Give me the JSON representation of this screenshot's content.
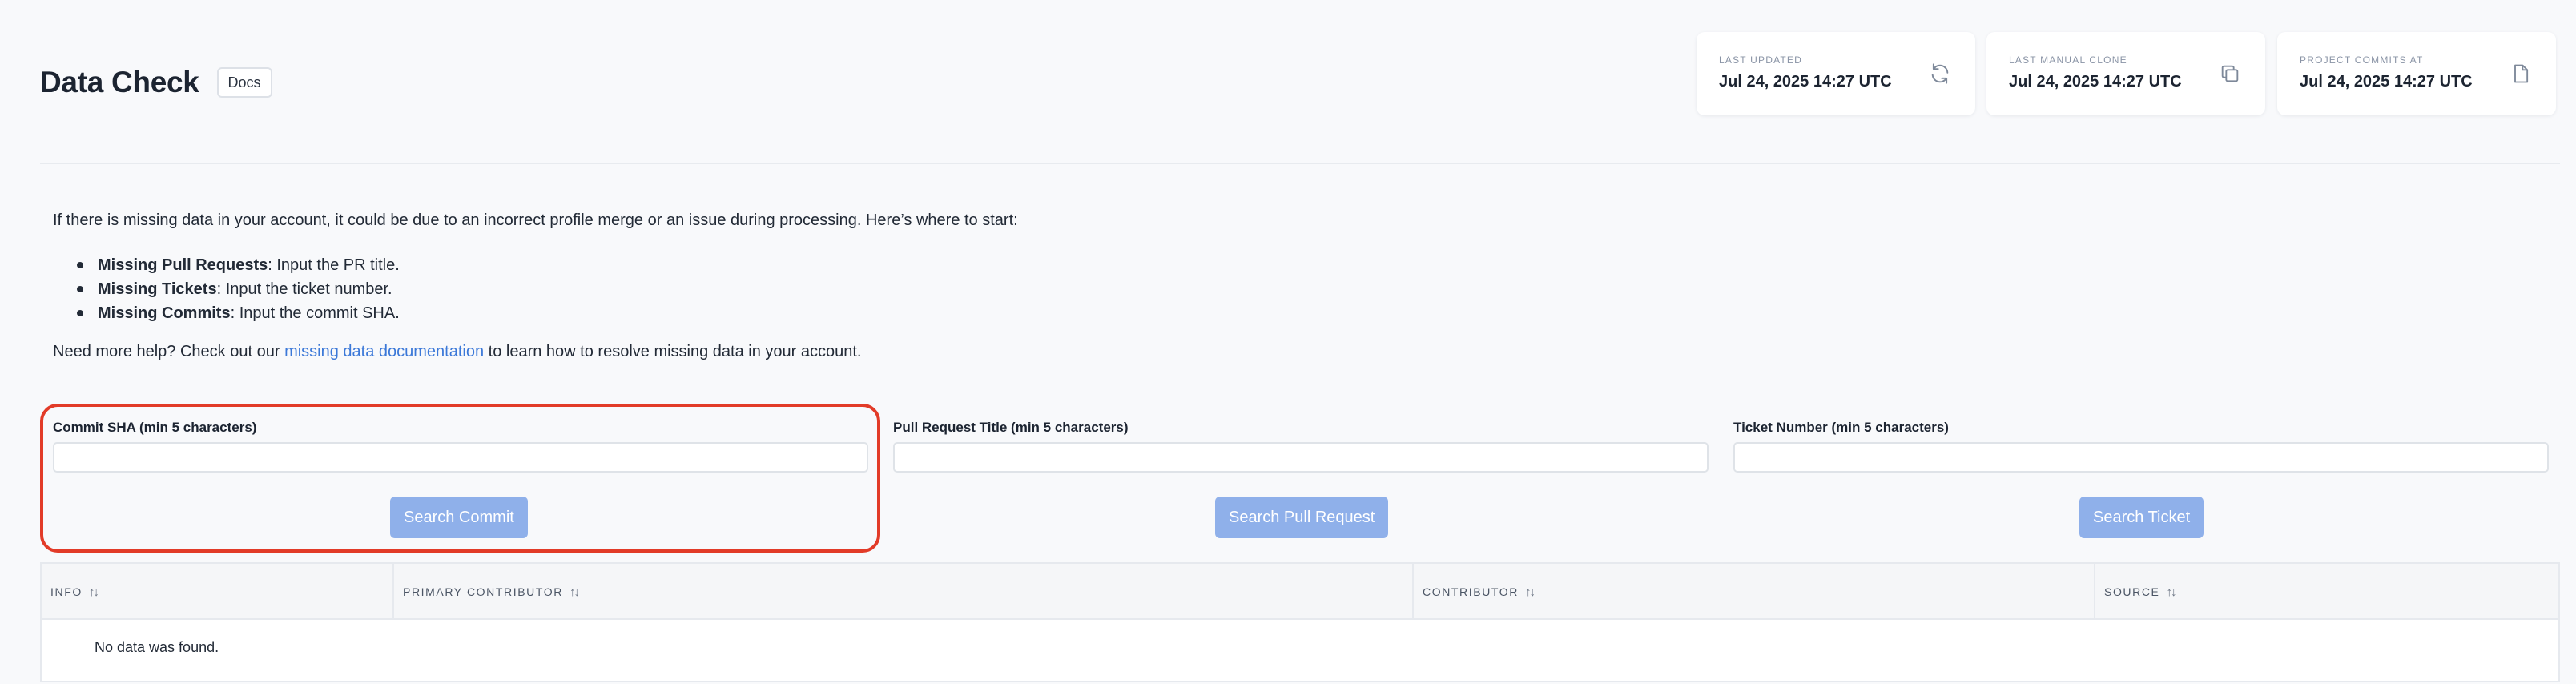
{
  "header": {
    "title": "Data Check",
    "docs_label": "Docs"
  },
  "stats": [
    {
      "label": "LAST UPDATED",
      "value": "Jul 24, 2025 14:27 UTC",
      "icon": "refresh-icon"
    },
    {
      "label": "LAST MANUAL CLONE",
      "value": "Jul 24, 2025 14:27 UTC",
      "icon": "copy-icon"
    },
    {
      "label": "PROJECT COMMITS AT",
      "value": "Jul 24, 2025 14:27 UTC",
      "icon": "document-icon"
    }
  ],
  "intro": {
    "text": "If there is missing data in your account, it could be due to an incorrect profile merge or an issue during processing. Here’s where to start:",
    "bullets": [
      {
        "bold": "Missing Pull Requests",
        "rest": ": Input the PR title."
      },
      {
        "bold": "Missing Tickets",
        "rest": ": Input the ticket number."
      },
      {
        "bold": "Missing Commits",
        "rest": ": Input the commit SHA."
      }
    ],
    "help_prefix": "Need more help? Check out our ",
    "help_link": "missing data documentation",
    "help_suffix": " to learn how to resolve missing data in your account."
  },
  "search": {
    "commit": {
      "label": "Commit SHA (min 5 characters)",
      "value": "",
      "button": "Search Commit"
    },
    "pull_request": {
      "label": "Pull Request Title (min 5 characters)",
      "value": "",
      "button": "Search Pull Request"
    },
    "ticket": {
      "label": "Ticket Number (min 5 characters)",
      "value": "",
      "button": "Search Ticket"
    }
  },
  "table": {
    "columns": [
      "INFO",
      "PRIMARY CONTRIBUTOR",
      "CONTRIBUTOR",
      "SOURCE"
    ],
    "sort_glyph": "↑↓",
    "empty_text": "No data was found."
  },
  "colors": {
    "accent_link": "#3b78d8",
    "button_disabled": "#8fb0ea",
    "highlight": "#e23b28"
  }
}
